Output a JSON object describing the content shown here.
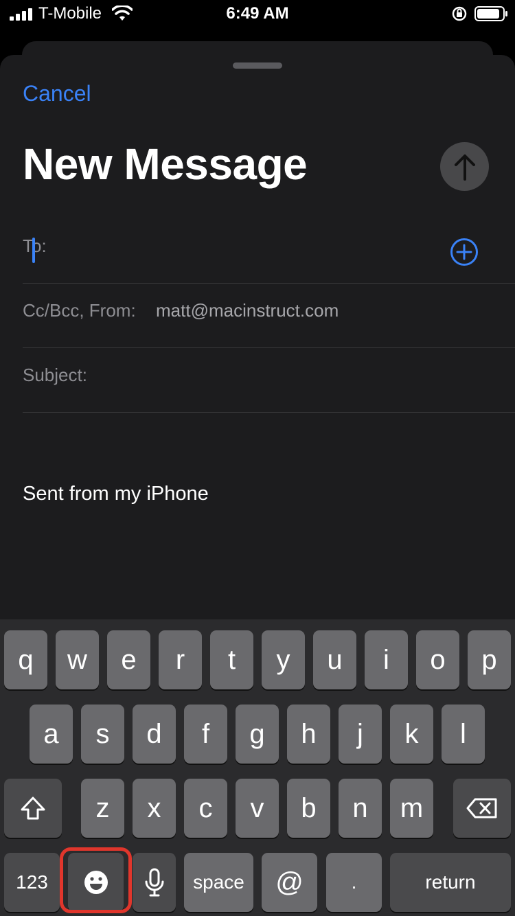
{
  "status_bar": {
    "carrier": "T-Mobile",
    "time": "6:49 AM",
    "icons": [
      "signal-icon",
      "wifi-icon",
      "orientation-lock-icon",
      "battery-icon"
    ]
  },
  "compose": {
    "cancel_label": "Cancel",
    "title": "New Message",
    "to_label": "To:",
    "ccbcc_label": "Cc/Bcc, From:",
    "from_value": "matt@macinstruct.com",
    "subject_label": "Subject:",
    "signature": "Sent from my iPhone"
  },
  "keyboard": {
    "row1": [
      "q",
      "w",
      "e",
      "r",
      "t",
      "y",
      "u",
      "i",
      "o",
      "p"
    ],
    "row2": [
      "a",
      "s",
      "d",
      "f",
      "g",
      "h",
      "j",
      "k",
      "l"
    ],
    "row3": [
      "z",
      "x",
      "c",
      "v",
      "b",
      "n",
      "m"
    ],
    "numbers_label": "123",
    "space_label": "space",
    "at_label": "@",
    "period_label": ".",
    "return_label": "return"
  },
  "colors": {
    "accent": "#3a82f7",
    "highlight": "#e0362c"
  }
}
